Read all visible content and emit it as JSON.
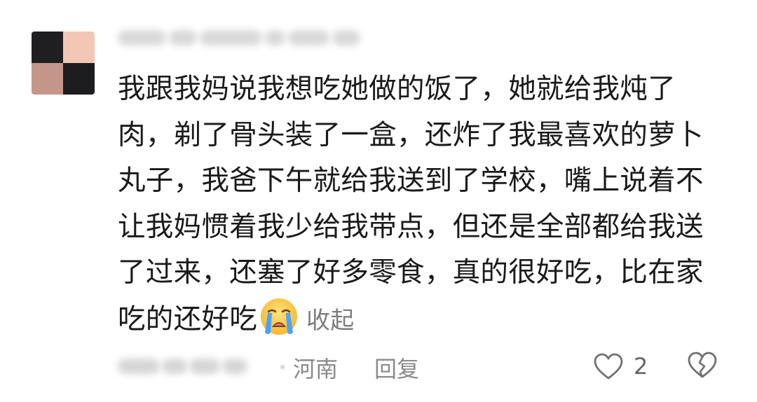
{
  "avatar": {
    "tiles": [
      "#1f1f21",
      "#f2c7b6",
      "#c4968a",
      "#1d1d1f"
    ]
  },
  "comment": {
    "lines": [
      "我跟我妈说我想吃她做的饭了，她就给我炖了",
      "肉，剃了骨头装了一盒，还炸了我最喜欢的萝卜",
      "丸子，我爸下午就给我送到了学校，嘴上说着不",
      "让我妈惯着我少给我带点，但还是全部都给我送",
      "了过来，还塞了好多零食，真的很好吃，比在家",
      "吃的还好吃"
    ],
    "emoji": "loudly-crying-face-icon",
    "collapse_label": "收起"
  },
  "meta": {
    "location": "河南",
    "reply_label": "回复",
    "like_count": "2"
  },
  "colors": {
    "text": "#1a1a1a",
    "muted": "#8a8a8a",
    "link": "#7d7d7d"
  }
}
